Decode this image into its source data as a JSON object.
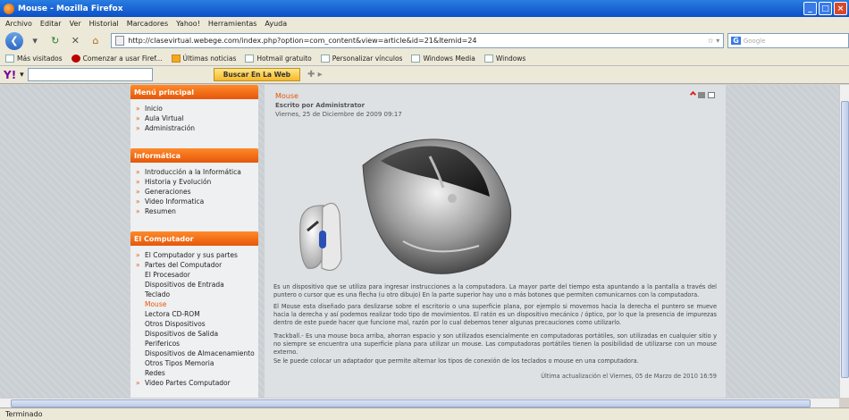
{
  "window": {
    "title": "Mouse - Mozilla Firefox"
  },
  "menubar": [
    "Archivo",
    "Editar",
    "Ver",
    "Historial",
    "Marcadores",
    "Yahoo!",
    "Herramientas",
    "Ayuda"
  ],
  "navbar": {
    "url": "http://clasevirtual.webege.com/index.php?option=com_content&view=article&id=21&Itemid=24",
    "search_placeholder": "Google",
    "search_engine_badge": "G"
  },
  "bookmarks": [
    "Más visitados",
    "Comenzar a usar Firef...",
    "Últimas noticias",
    "Hotmail gratuito",
    "Personalizar vínculos",
    "Windows Media",
    "Windows"
  ],
  "yahoobar": {
    "logo": "Y!",
    "button": "Buscar En La Web"
  },
  "sidebar": {
    "menu_principal": {
      "title": "Menú principal",
      "items": [
        "Inicio",
        "Aula Virtual",
        "Administración"
      ]
    },
    "informatica": {
      "title": "Informática",
      "items": [
        "Introducción a la Informática",
        "Historia y Evolución",
        "Generaciones",
        "Video Informatica",
        "Resumen"
      ]
    },
    "computador": {
      "title": "El Computador",
      "items": [
        "El Computador y sus partes",
        "Partes del Computador"
      ],
      "subitems": [
        "El Procesador",
        "Dispositivos de Entrada",
        "Teclado",
        "Mouse",
        "Lectora CD-ROM",
        "Otros Dispositivos",
        "Dispositivos de Salida",
        "Perifericos",
        "Dispositivos de Almacenamiento",
        "Otros Tipos Memoria",
        "Redes"
      ],
      "active": "Mouse",
      "last": "Video Partes Computador"
    }
  },
  "article": {
    "title": "Mouse",
    "author": "Escrito por Administrator",
    "date": "Viernes, 25 de Diciembre de 2009 09:17",
    "paragraphs": [
      "Es un dispositivo que se utiliza para ingresar instrucciones a la computadora. La mayor parte del tiempo esta apuntando a la pantalla a través del puntero o cursor que es una flecha (u otro dibujo) En la parte superior hay uno o más botones que permiten comunicarnos con la computadora.",
      "El Mouse esta diseñado para deslizarse sobre el escritorio o una superficie plana, por ejemplo si movemos hacia la derecha el puntero se mueve hacia la derecha y así podemos realizar todo tipo de movimientos. El ratón es un dispositivo mecánico / óptico, por lo que la presencia de impurezas dentro de este puede hacer que funcione mal, razón por lo cual debemos tener algunas precauciones como utilizarlo.",
      "Trackball.- Es una mouse boca arriba, ahorran espacio y son utilizados esencialmente en computadoras portátiles, son utilizadas en cualquier sitio y no siempre se encuentra una superficie plana para utilizar un mouse. Las computadoras portátiles tienen la posibilidad de utilizarse con un mouse externo.",
      "Se le puede colocar un adaptador que permite alternar los tipos de conexión de los teclados o mouse en una computadora."
    ],
    "updated": "Última actualización el Viernes, 05 de Marzo de 2010 16:59"
  },
  "statusbar": {
    "text": "Terminado"
  },
  "colors": {
    "accent": "#e5570a",
    "titlebar": "#0b4fc7"
  }
}
